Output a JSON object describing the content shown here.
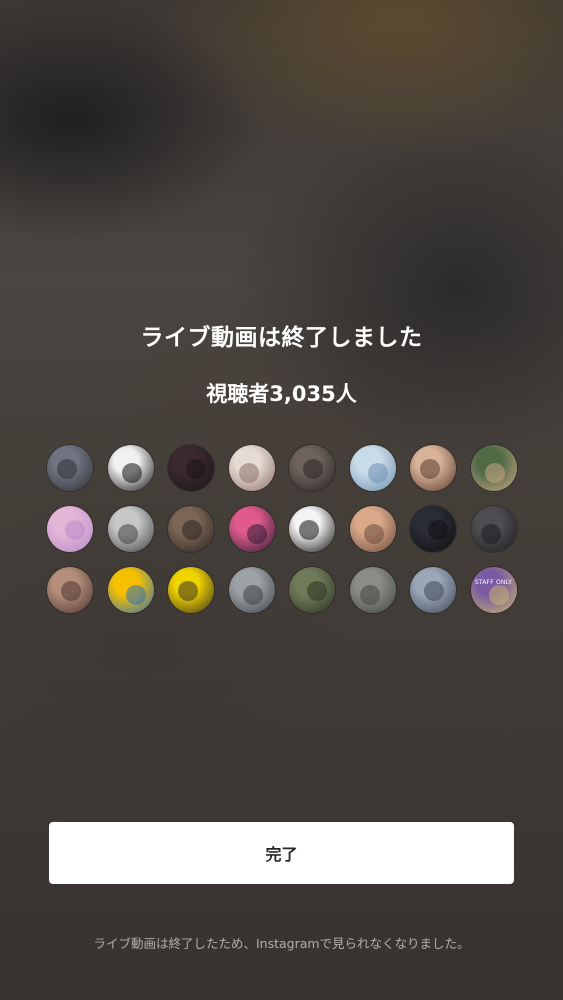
{
  "live_end": {
    "title": "ライブ動画は終了しました",
    "viewers": "視聴者3,035人",
    "done_button": "完了",
    "footer_note": "ライブ動画は終了したため、Instagramで見られなくなりました。"
  },
  "viewer_avatars": [
    {
      "name": "viewer-avatar-1",
      "colors": [
        "#6f7480",
        "#2d2f36"
      ]
    },
    {
      "name": "viewer-avatar-2",
      "colors": [
        "#f1f1f1",
        "#111111"
      ]
    },
    {
      "name": "viewer-avatar-3",
      "colors": [
        "#3a2a30",
        "#1a1416"
      ]
    },
    {
      "name": "viewer-avatar-4",
      "colors": [
        "#e7dcd4",
        "#8a6f68"
      ]
    },
    {
      "name": "viewer-avatar-5",
      "colors": [
        "#6d625c",
        "#2a2522"
      ]
    },
    {
      "name": "viewer-avatar-6",
      "colors": [
        "#c9dbe8",
        "#6e8fb0"
      ]
    },
    {
      "name": "viewer-avatar-7",
      "colors": [
        "#d8b39a",
        "#5a3a2c"
      ]
    },
    {
      "name": "viewer-avatar-8",
      "colors": [
        "#4f6a45",
        "#caa585"
      ]
    },
    {
      "name": "viewer-avatar-9",
      "colors": [
        "#e3b6d6",
        "#b889c9"
      ]
    },
    {
      "name": "viewer-avatar-10",
      "colors": [
        "#c7c7c7",
        "#3c3f44"
      ]
    },
    {
      "name": "viewer-avatar-11",
      "colors": [
        "#7b6656",
        "#2a2420"
      ]
    },
    {
      "name": "viewer-avatar-12",
      "colors": [
        "#e05a8c",
        "#2a1e33"
      ]
    },
    {
      "name": "viewer-avatar-13",
      "colors": [
        "#f4f4f4",
        "#111111"
      ]
    },
    {
      "name": "viewer-avatar-14",
      "colors": [
        "#d9a98a",
        "#6a4a3c"
      ]
    },
    {
      "name": "viewer-avatar-15",
      "colors": [
        "#2a2c33",
        "#0e0f12"
      ]
    },
    {
      "name": "viewer-avatar-16",
      "colors": [
        "#4e4e52",
        "#1c1c1f"
      ]
    },
    {
      "name": "viewer-avatar-17",
      "colors": [
        "#b58f7a",
        "#4a3330"
      ]
    },
    {
      "name": "viewer-avatar-18",
      "colors": [
        "#f5c000",
        "#2f6fb8"
      ]
    },
    {
      "name": "viewer-avatar-19",
      "colors": [
        "#f0d400",
        "#3a3020"
      ]
    },
    {
      "name": "viewer-avatar-20",
      "colors": [
        "#9da2a6",
        "#3e4246"
      ]
    },
    {
      "name": "viewer-avatar-21",
      "colors": [
        "#6f7a58",
        "#2c3222"
      ]
    },
    {
      "name": "viewer-avatar-22",
      "colors": [
        "#8a8c86",
        "#444640"
      ]
    },
    {
      "name": "viewer-avatar-23",
      "colors": [
        "#9aa7b8",
        "#3f4756"
      ]
    },
    {
      "name": "viewer-avatar-24",
      "colors": [
        "#7a5aa3",
        "#c9b66a"
      ],
      "caption": "STAFF ONLY"
    }
  ]
}
